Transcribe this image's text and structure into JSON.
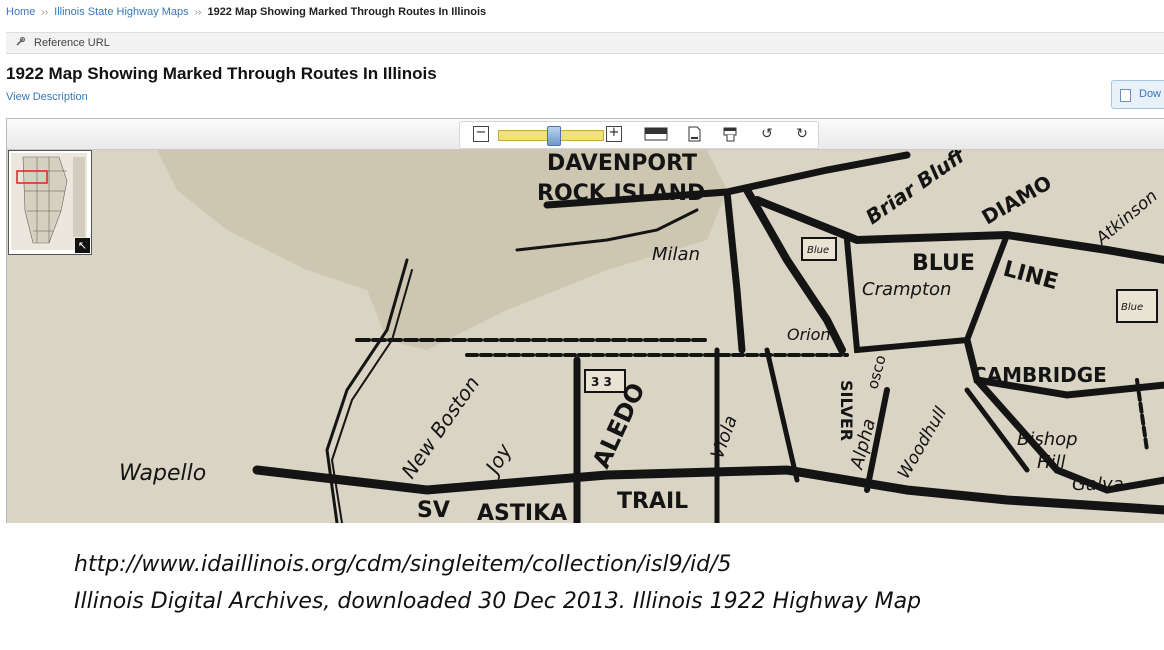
{
  "breadcrumb": {
    "home": "Home",
    "sep": "››",
    "section": "Illinois State Highway Maps",
    "current": "1922 Map Showing Marked Through Routes In Illinois"
  },
  "reference": {
    "label": "Reference URL",
    "icon": "link-icon"
  },
  "item": {
    "title": "1922 Map Showing Marked Through Routes In Illinois",
    "view_description": "View Description",
    "download_label": "Dow"
  },
  "toolbar": {
    "zoom_out": "−",
    "zoom_in": "+",
    "zoom_level": 0.52,
    "rotate_left": "↺",
    "rotate_right": "↻",
    "icons": [
      "zoom-out-icon",
      "zoom-slider",
      "zoom-in-icon",
      "fit-window-icon",
      "fit-page-icon",
      "fit-width-icon",
      "rotate-left-icon",
      "rotate-right-icon"
    ]
  },
  "map": {
    "labels": {
      "davenport": "DAVENPORT",
      "rock_island": "ROCK ISLAND",
      "milan": "Milan",
      "briar_bluff": "Briar Bluff",
      "diamond": "DIAMO",
      "blue_line_1": "BLUE",
      "blue_line_2": "LINE",
      "crampton": "Crampton",
      "atkinson": "Atkinson",
      "orion": "Orion",
      "cambridge": "CAMBRIDGE",
      "wapello": "Wapello",
      "new_boston": "New Boston",
      "joy": "Joy",
      "aledo": "ALEDO",
      "viola": "Viola",
      "alpha": "Alpha",
      "woodhull": "Woodhull",
      "bishop_hill_1": "Bishop",
      "bishop_hill_2": "Hill",
      "galva": "Galva",
      "swastika_1": "SV",
      "swastika_2": "ASTIKA",
      "trail": "TRAIL",
      "route_sign": "3 3",
      "blue_sign": "Blue",
      "silver": "SILVER",
      "moscow": "osco"
    },
    "colors": {
      "paper": "#d9d4c4",
      "ink": "#141414",
      "water": "#cdc6b1"
    }
  },
  "thumbnail": {
    "expand_icon": "↖"
  },
  "caption": {
    "line1": "http://www.idaillinois.org/cdm/singleitem/collection/isl9/id/5",
    "line2": "Illinois Digital Archives, downloaded 30 Dec 2013. Illinois 1922 Highway Map"
  }
}
